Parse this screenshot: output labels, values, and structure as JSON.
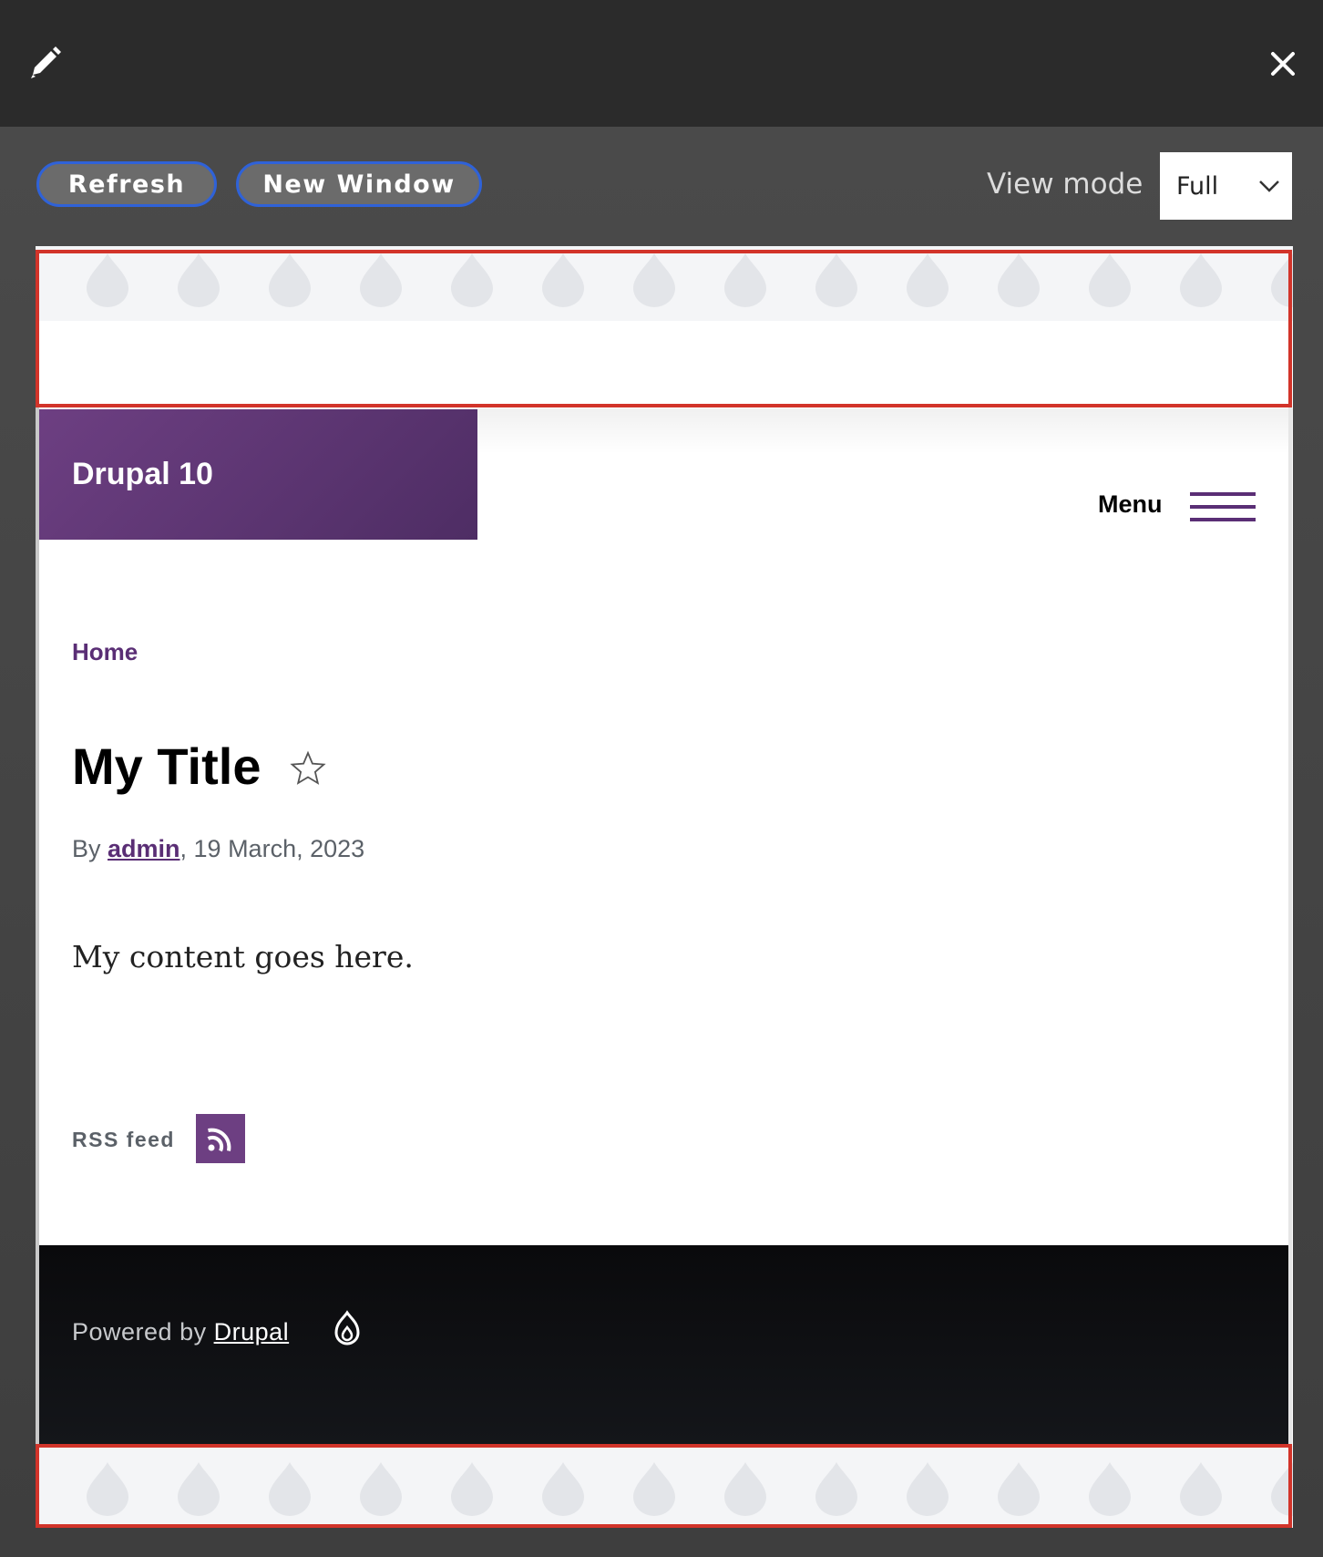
{
  "toolbar": {
    "refresh_label": "Refresh",
    "new_window_label": "New Window",
    "view_mode_label": "View mode",
    "view_mode_value": "Full"
  },
  "site": {
    "name": "Drupal 10",
    "menu_label": "Menu"
  },
  "page": {
    "breadcrumb": "Home",
    "title": "My Title",
    "byline_prefix": "By ",
    "author": "admin",
    "date": ", 19 March, 2023",
    "body": "My content goes here.",
    "rss_label": "RSS feed"
  },
  "footer": {
    "powered_prefix": "Powered by ",
    "drupal_link": "Drupal"
  },
  "colors": {
    "brand": "#6d3f82",
    "highlight": "#d2342a",
    "button_border": "#2f62d8"
  },
  "icons": [
    "pencil-icon",
    "close-icon",
    "chevron-down-icon",
    "star-icon",
    "rss-icon",
    "drupal-drop-icon"
  ]
}
